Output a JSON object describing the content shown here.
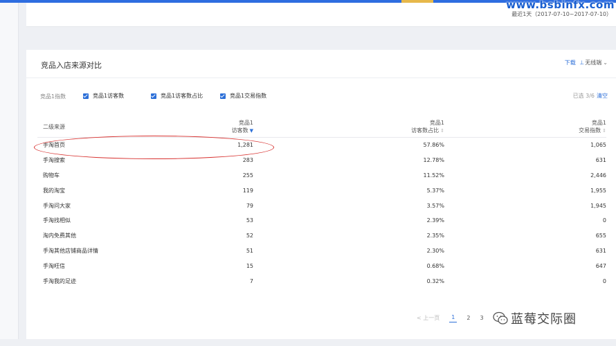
{
  "watermark": "www.bsbinfx.com",
  "date_range": "最近1天（2017-07-10~2017-07-10）",
  "section": {
    "title": "竞品入店来源对比",
    "download_label": "下载",
    "wireless_label": "无线端"
  },
  "filters": {
    "group_label": "竞品1指数",
    "options": [
      {
        "label": "竞品1访客数",
        "checked": true
      },
      {
        "label": "竞品1访客数占比",
        "checked": true
      },
      {
        "label": "竞品1交易指数",
        "checked": true
      }
    ],
    "selected_text": "已选 3/6",
    "clear_label": "清空"
  },
  "table": {
    "headers": {
      "source": "二级来源",
      "visitors_l1": "竞品1",
      "visitors_l2": "访客数",
      "share_l1": "竞品1",
      "share_l2": "访客数占比",
      "trade_l1": "竞品1",
      "trade_l2": "交易指数"
    },
    "sort": {
      "visitors": "▼",
      "share": "⇕",
      "trade": "⇕"
    },
    "rows": [
      {
        "source": "手淘首页",
        "visitors": "1,281",
        "share": "57.86%",
        "trade": "1,065"
      },
      {
        "source": "手淘搜索",
        "visitors": "283",
        "share": "12.78%",
        "trade": "631"
      },
      {
        "source": "购物车",
        "visitors": "255",
        "share": "11.52%",
        "trade": "2,446"
      },
      {
        "source": "我的淘宝",
        "visitors": "119",
        "share": "5.37%",
        "trade": "1,955"
      },
      {
        "source": "手淘问大家",
        "visitors": "79",
        "share": "3.57%",
        "trade": "1,945"
      },
      {
        "source": "手淘找相似",
        "visitors": "53",
        "share": "2.39%",
        "trade": "0"
      },
      {
        "source": "淘内免费其他",
        "visitors": "52",
        "share": "2.35%",
        "trade": "655"
      },
      {
        "source": "手淘其他店铺商品详情",
        "visitors": "51",
        "share": "2.30%",
        "trade": "631"
      },
      {
        "source": "手淘旺信",
        "visitors": "15",
        "share": "0.68%",
        "trade": "647"
      },
      {
        "source": "手淘我的足迹",
        "visitors": "7",
        "share": "0.32%",
        "trade": "0"
      }
    ]
  },
  "pagination": {
    "prev_label": "< 上一页",
    "pages": [
      "1",
      "2",
      "3"
    ],
    "current": "1"
  },
  "brand_text": "蓝莓交际圈",
  "colors": {
    "accent": "#2c6fd8",
    "annotation_circle": "#d7302e",
    "top_bar": "#2e6de0"
  }
}
